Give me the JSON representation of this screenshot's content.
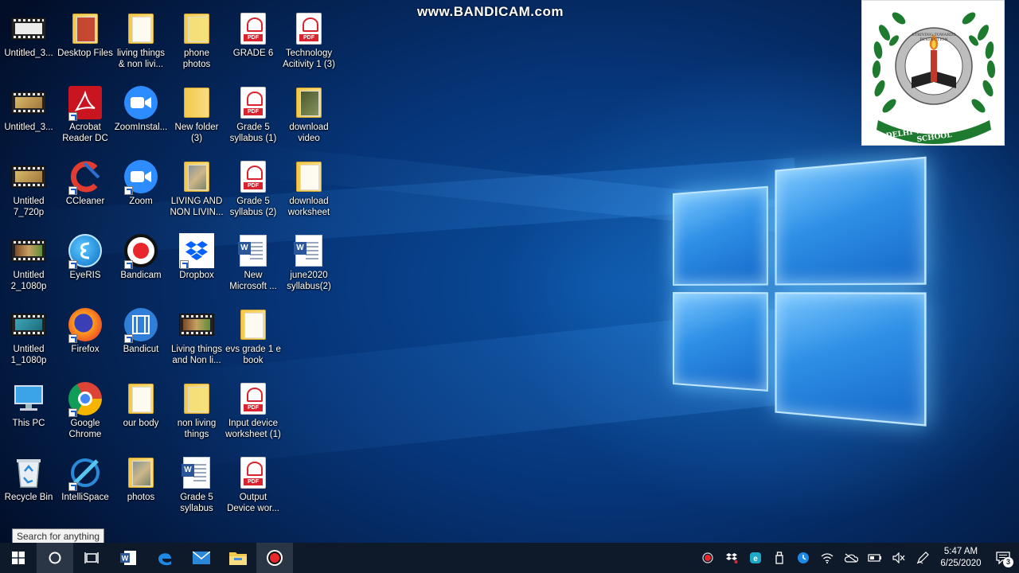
{
  "watermark": "www.BANDICAM.com",
  "school_logo": {
    "top_text": "STRIVING TOWARDS PERFECTION",
    "bottom_text": "DELHI WORLD PUBLIC SCHOOL"
  },
  "desktop_icons": {
    "c0r0": {
      "label": "Untitled_3...",
      "icon": "video-file-icon"
    },
    "c0r1": {
      "label": "Untitled_3...",
      "icon": "video-file-icon"
    },
    "c0r2": {
      "label": "Untitled\n7_720p",
      "icon": "video-file-icon"
    },
    "c0r3": {
      "label": "Untitled\n2_1080p",
      "icon": "video-file-icon"
    },
    "c0r4": {
      "label": "Untitled\n1_1080p",
      "icon": "video-file-icon"
    },
    "c0r5": {
      "label": "This PC",
      "icon": "this-pc-icon"
    },
    "c0r6": {
      "label": "Recycle Bin",
      "icon": "recycle-bin-icon"
    },
    "c1r0": {
      "label": "Desktop Files",
      "icon": "folder-icon"
    },
    "c1r1": {
      "label": "Acrobat\nReader DC",
      "icon": "acrobat-icon"
    },
    "c1r2": {
      "label": "CCleaner",
      "icon": "ccleaner-icon"
    },
    "c1r3": {
      "label": "EyeRIS",
      "icon": "eyeris-icon"
    },
    "c1r4": {
      "label": "Firefox",
      "icon": "firefox-icon"
    },
    "c1r5": {
      "label": "Google\nChrome",
      "icon": "chrome-icon"
    },
    "c1r6": {
      "label": "IntelliSpace",
      "icon": "intellispace-icon"
    },
    "c2r0": {
      "label": "living things\n& non livi...",
      "icon": "folder-icon"
    },
    "c2r1": {
      "label": "ZoomInstal...",
      "icon": "zoom-icon"
    },
    "c2r2": {
      "label": "Zoom",
      "icon": "zoom-icon"
    },
    "c2r3": {
      "label": "Bandicam",
      "icon": "bandicam-icon"
    },
    "c2r4": {
      "label": "Bandicut",
      "icon": "bandicut-icon"
    },
    "c2r5": {
      "label": "our body",
      "icon": "folder-icon"
    },
    "c2r6": {
      "label": "photos",
      "icon": "folder-icon"
    },
    "c3r0": {
      "label": "phone\nphotos",
      "icon": "folder-icon"
    },
    "c3r1": {
      "label": "New folder\n(3)",
      "icon": "folder-icon"
    },
    "c3r2": {
      "label": "LIVING AND\nNON LIVIN...",
      "icon": "folder-icon"
    },
    "c3r3": {
      "label": "Dropbox",
      "icon": "dropbox-icon"
    },
    "c3r4": {
      "label": "Living things\nand Non li...",
      "icon": "video-file-icon"
    },
    "c3r5": {
      "label": "non living\nthings",
      "icon": "folder-icon"
    },
    "c3r6": {
      "label": "Grade 5\nsyllabus",
      "icon": "word-doc-icon"
    },
    "c4r0": {
      "label": "GRADE 6",
      "icon": "pdf-icon"
    },
    "c4r1": {
      "label": "Grade 5\nsyllabus (1)",
      "icon": "pdf-icon"
    },
    "c4r2": {
      "label": "Grade 5\nsyllabus (2)",
      "icon": "pdf-icon"
    },
    "c4r3": {
      "label": "New\nMicrosoft ...",
      "icon": "word-doc-icon"
    },
    "c4r4": {
      "label": "evs grade 1 e\nbook",
      "icon": "folder-icon"
    },
    "c4r5": {
      "label": "Input device\nworksheet (1)",
      "icon": "pdf-icon"
    },
    "c4r6": {
      "label": "Output\nDevice wor...",
      "icon": "pdf-icon"
    },
    "c5r0": {
      "label": "Technology\nAcitivity 1 (3)",
      "icon": "pdf-icon"
    },
    "c5r1": {
      "label": "download\nvideo",
      "icon": "folder-icon"
    },
    "c5r2": {
      "label": "download\nworksheet",
      "icon": "folder-icon"
    },
    "c5r3": {
      "label": "june2020\nsyllabus(2)",
      "icon": "word-doc-icon"
    }
  },
  "pdf_badge": "PDF",
  "word_badge": "W",
  "search_tooltip": "Search for anything",
  "taskbar": {
    "pinned": [
      "windows-start-icon",
      "cortana-search-icon",
      "task-view-icon",
      "word-icon",
      "edge-icon",
      "mail-icon",
      "file-explorer-icon",
      "bandicam-record-icon"
    ]
  },
  "tray": {
    "icons": [
      "record-icon",
      "dropbox-icon",
      "bluetooth-app-icon",
      "usb-icon",
      "clock-app-icon",
      "wifi-icon",
      "onedrive-icon",
      "battery-icon",
      "volume-muted-icon",
      "pen-icon"
    ],
    "time": "5:47 AM",
    "date": "6/25/2020",
    "notification_count": "3"
  },
  "colors": {
    "taskbar": "#0e1a2a",
    "wallpaper_blue": "#0a4fa0",
    "pdf_red": "#d9232e",
    "zoom_blue": "#2d8cff"
  }
}
